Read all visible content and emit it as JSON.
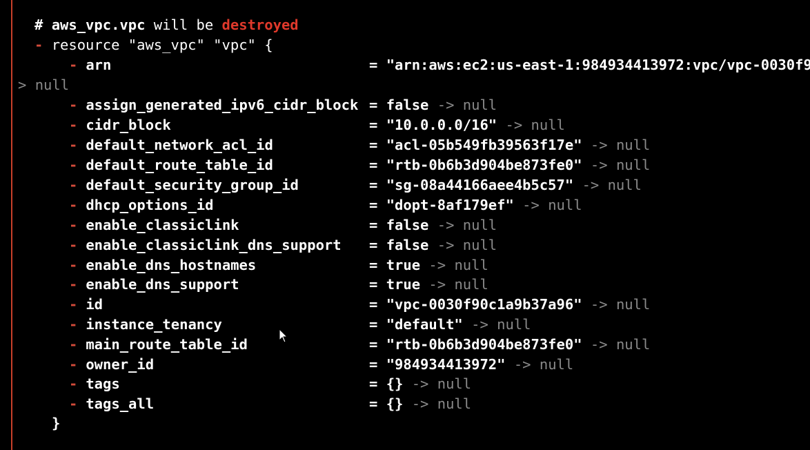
{
  "header": {
    "hash": "#",
    "resource_name": "aws_vpc.vpc",
    "will_be": "will be",
    "action": "destroyed",
    "resource_dash": "-",
    "resource_decl": "resource \"aws_vpc\" \"vpc\" {"
  },
  "arrow": "->",
  "null_word": "null",
  "wrap": {
    "gt": ">",
    "text": "null"
  },
  "attributes": [
    {
      "key": "arn",
      "value": "\"arn:aws:ec2:us-east-1:984934413972:vpc/vpc-0030f9",
      "show_arrow": false
    },
    {
      "key": "assign_generated_ipv6_cidr_block",
      "value": "false",
      "show_arrow": true
    },
    {
      "key": "cidr_block",
      "value": "\"10.0.0.0/16\"",
      "show_arrow": true
    },
    {
      "key": "default_network_acl_id",
      "value": "\"acl-05b549fb39563f17e\"",
      "show_arrow": true
    },
    {
      "key": "default_route_table_id",
      "value": "\"rtb-0b6b3d904be873fe0\"",
      "show_arrow": true
    },
    {
      "key": "default_security_group_id",
      "value": "\"sg-08a44166aee4b5c57\"",
      "show_arrow": true
    },
    {
      "key": "dhcp_options_id",
      "value": "\"dopt-8af179ef\"",
      "show_arrow": true
    },
    {
      "key": "enable_classiclink",
      "value": "false",
      "show_arrow": true
    },
    {
      "key": "enable_classiclink_dns_support",
      "value": "false",
      "show_arrow": true
    },
    {
      "key": "enable_dns_hostnames",
      "value": "true",
      "show_arrow": true
    },
    {
      "key": "enable_dns_support",
      "value": "true",
      "show_arrow": true
    },
    {
      "key": "id",
      "value": "\"vpc-0030f90c1a9b37a96\"",
      "show_arrow": true
    },
    {
      "key": "instance_tenancy",
      "value": "\"default\"",
      "show_arrow": true
    },
    {
      "key": "main_route_table_id",
      "value": "\"rtb-0b6b3d904be873fe0\"",
      "show_arrow": true
    },
    {
      "key": "owner_id",
      "value": "\"984934413972\"",
      "show_arrow": true
    },
    {
      "key": "tags",
      "value": "{}",
      "show_arrow": true
    },
    {
      "key": "tags_all",
      "value": "{}",
      "show_arrow": true
    }
  ],
  "attr_dash": "-",
  "equals": "=",
  "closing_brace": "}",
  "colors": {
    "background": "#000000",
    "text": "#ffffff",
    "destroy_red": "#e0392b",
    "dash_red": "#d24b3a",
    "muted_gray": "#8a8a8a",
    "border_accent": "#c8402a"
  }
}
